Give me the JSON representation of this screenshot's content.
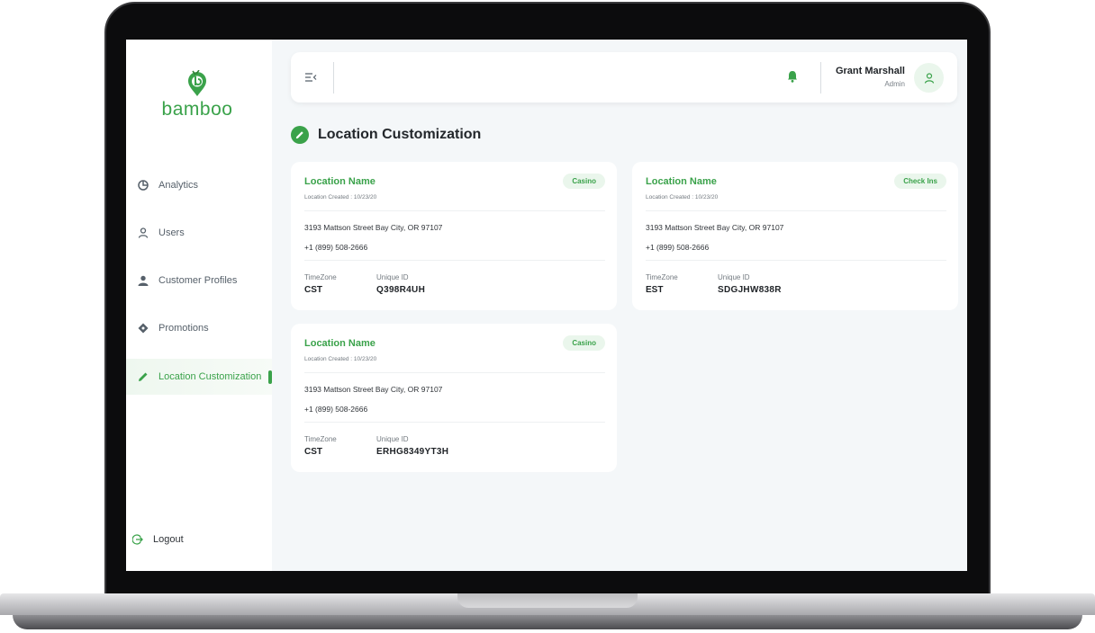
{
  "app": {
    "logo_text": "bamboo",
    "brand_color": "#3aa24a"
  },
  "sidebar": {
    "items": [
      {
        "label": "Analytics",
        "icon": "pie-chart-icon"
      },
      {
        "label": "Users",
        "icon": "user-icon"
      },
      {
        "label": "Customer Profiles",
        "icon": "customer-profile-icon"
      },
      {
        "label": "Promotions",
        "icon": "tag-icon"
      },
      {
        "label": "Location Customization",
        "icon": "pencil-icon",
        "active": true
      }
    ],
    "logout_label": "Logout"
  },
  "header": {
    "user_name": "Grant Marshall",
    "user_role": "Admin"
  },
  "page": {
    "title": "Location Customization"
  },
  "cards": [
    {
      "name": "Location Name",
      "created": "Location Created : 10/23/20",
      "badge": "Casino",
      "address": "3193 Mattson Street Bay City, OR 97107",
      "phone": "+1 (899) 508-2666",
      "timezone_label": "TimeZone",
      "timezone": "CST",
      "uid_label": "Unique ID",
      "uid": "Q398R4UH"
    },
    {
      "name": "Location Name",
      "created": "Location Created : 10/23/20",
      "badge": "Check Ins",
      "address": "3193 Mattson Street Bay City, OR 97107",
      "phone": "+1 (899) 508-2666",
      "timezone_label": "TimeZone",
      "timezone": "EST",
      "uid_label": "Unique ID",
      "uid": "SDGJHW838R"
    },
    {
      "name": "Location Name",
      "created": "Location Created : 10/23/20",
      "badge": "Casino",
      "address": "3193 Mattson Street Bay City, OR 97107",
      "phone": "+1 (899) 508-2666",
      "timezone_label": "TimeZone",
      "timezone": "CST",
      "uid_label": "Unique ID",
      "uid": "ERHG8349YT3H"
    }
  ]
}
